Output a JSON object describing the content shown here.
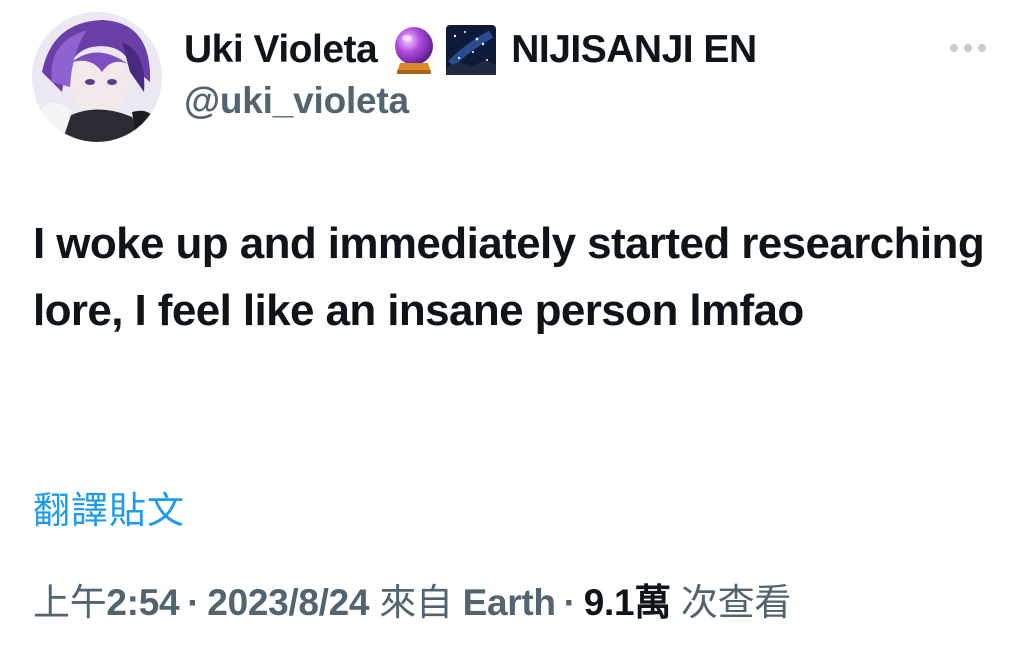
{
  "author": {
    "display_name": "Uki Violeta",
    "emoji_1": "crystal-ball-emoji",
    "emoji_2": "milky-way-emoji",
    "affiliation": "NIJISANJI EN",
    "handle": "@uki_violeta"
  },
  "tweet": {
    "text": "I woke up and immediately started researching lore, I feel like an insane person lmfao",
    "translate_label": "翻譯貼文"
  },
  "meta": {
    "time_prefix": "上午",
    "time": "2:54",
    "separator": "·",
    "date": "2023/8/24",
    "source_prefix": "來自",
    "source": "Earth",
    "views_count": "9.1萬",
    "views_label": "次查看"
  },
  "colors": {
    "text_primary": "#0f1419",
    "text_secondary": "#536471",
    "link": "#1d9bf0"
  }
}
